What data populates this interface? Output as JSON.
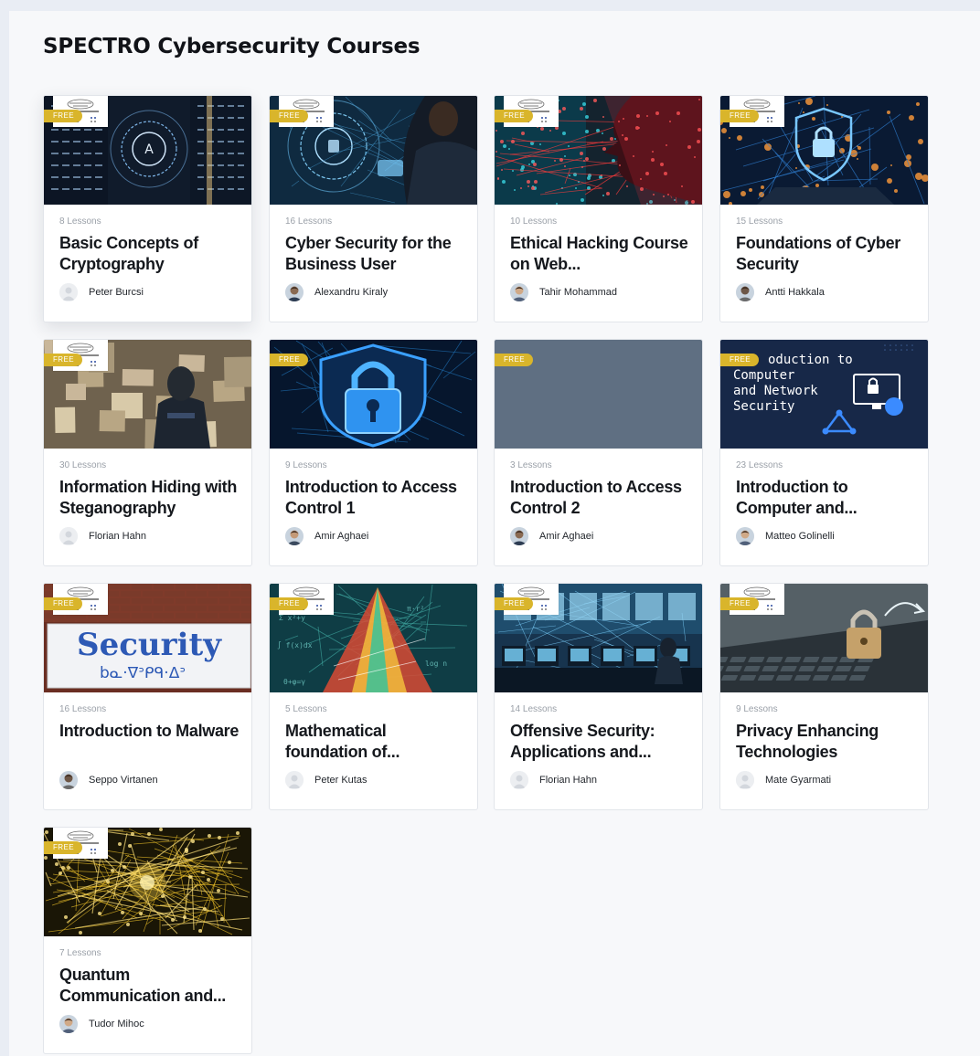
{
  "page": {
    "title": "SPECTRO Cybersecurity Courses"
  },
  "colors": {
    "badge": "#d9b52b",
    "background": "#f7f8fa",
    "outer": "#e9edf4"
  },
  "courses": [
    {
      "title": "Basic Concepts of Cryptography",
      "lessons": "8 Lessons",
      "author": "Peter Burcsi",
      "badge": "FREE",
      "avatar": "placeholder",
      "thumb": "crypto",
      "has_logo": true
    },
    {
      "title": "Cyber Security for the Business User",
      "lessons": "16 Lessons",
      "author": "Alexandru Kiraly",
      "badge": "FREE",
      "avatar": "photo",
      "thumb": "business",
      "has_logo": true
    },
    {
      "title": "Ethical Hacking Course on Web...",
      "lessons": "10 Lessons",
      "author": "Tahir Mohammad",
      "badge": "FREE",
      "avatar": "photo",
      "thumb": "hacking",
      "has_logo": true
    },
    {
      "title": "Foundations of Cyber Security",
      "lessons": "15 Lessons",
      "author": "Antti Hakkala",
      "badge": "FREE",
      "avatar": "photo",
      "thumb": "foundations",
      "has_logo": true
    },
    {
      "title": "Information Hiding with Steganography",
      "lessons": "30 Lessons",
      "author": "Florian Hahn",
      "badge": "FREE",
      "avatar": "placeholder",
      "thumb": "stego",
      "has_logo": true
    },
    {
      "title": "Introduction to Access Control 1",
      "lessons": "9 Lessons",
      "author": "Amir Aghaei",
      "badge": "FREE",
      "avatar": "photo",
      "thumb": "lock",
      "has_logo": false
    },
    {
      "title": "Introduction to Access Control 2",
      "lessons": "3 Lessons",
      "author": "Amir Aghaei",
      "badge": "FREE",
      "avatar": "photo",
      "thumb": "blank",
      "has_logo": false
    },
    {
      "title": "Introduction to Computer and...",
      "lessons": "23 Lessons",
      "author": "Matteo Golinelli",
      "badge": "FREE",
      "avatar": "photo",
      "thumb": "network",
      "has_logo": false,
      "thumb_text": [
        "oduction to",
        "Computer",
        "and Network",
        "Security"
      ]
    },
    {
      "title": "Introduction to Malware",
      "lessons": "16 Lessons",
      "author": "Seppo Virtanen",
      "badge": "FREE",
      "avatar": "photo",
      "thumb": "malware",
      "has_logo": true,
      "thumb_text": [
        "Security",
        "bᓇ·ᐁᐣᑭᑫ·ᐃᐣ"
      ]
    },
    {
      "title": "Mathematical foundation of...",
      "lessons": "5 Lessons",
      "author": "Peter Kutas",
      "badge": "FREE",
      "avatar": "placeholder",
      "thumb": "math",
      "has_logo": true
    },
    {
      "title": "Offensive Security: Applications and...",
      "lessons": "14 Lessons",
      "author": "Florian Hahn",
      "badge": "FREE",
      "avatar": "placeholder",
      "thumb": "offensive",
      "has_logo": true
    },
    {
      "title": "Privacy Enhancing Technologies",
      "lessons": "9 Lessons",
      "author": "Mate Gyarmati",
      "badge": "FREE",
      "avatar": "placeholder",
      "thumb": "privacy",
      "has_logo": true
    },
    {
      "title": "Quantum Communication and...",
      "lessons": "7 Lessons",
      "author": "Tudor Mihoc",
      "badge": "FREE",
      "avatar": "photo",
      "thumb": "quantum",
      "has_logo": true
    }
  ]
}
